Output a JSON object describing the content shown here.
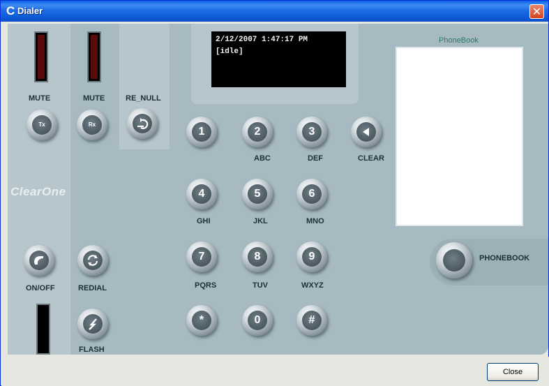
{
  "window": {
    "title": "Dialer",
    "close_glyph": "✕"
  },
  "display": {
    "line1": "2/12/2007 1:47:17 PM",
    "line2": "[idle]"
  },
  "left": {
    "mute_tx": {
      "label": "MUTE",
      "face": "Tx"
    },
    "mute_rx": {
      "label": "MUTE",
      "face": "Rx"
    },
    "re_null": {
      "label": "RE_NULL"
    },
    "on_off": {
      "label": "ON/OFF"
    },
    "redial": {
      "label": "REDIAL"
    },
    "flash": {
      "label": "FLASH"
    }
  },
  "brand": "ClearOne",
  "keypad": [
    {
      "key": "1",
      "letters": ""
    },
    {
      "key": "2",
      "letters": "ABC"
    },
    {
      "key": "3",
      "letters": "DEF"
    },
    {
      "key": "4",
      "letters": "GHI"
    },
    {
      "key": "5",
      "letters": "JKL"
    },
    {
      "key": "6",
      "letters": "MNO"
    },
    {
      "key": "7",
      "letters": "PQRS"
    },
    {
      "key": "8",
      "letters": "TUV"
    },
    {
      "key": "9",
      "letters": "WXYZ"
    },
    {
      "key": "*",
      "letters": ""
    },
    {
      "key": "0",
      "letters": ""
    },
    {
      "key": "#",
      "letters": ""
    }
  ],
  "clear": {
    "label": "CLEAR"
  },
  "phonebook": {
    "title": "PhoneBook",
    "button_label": "PHONEBOOK"
  },
  "footer": {
    "close_label": "Close"
  }
}
